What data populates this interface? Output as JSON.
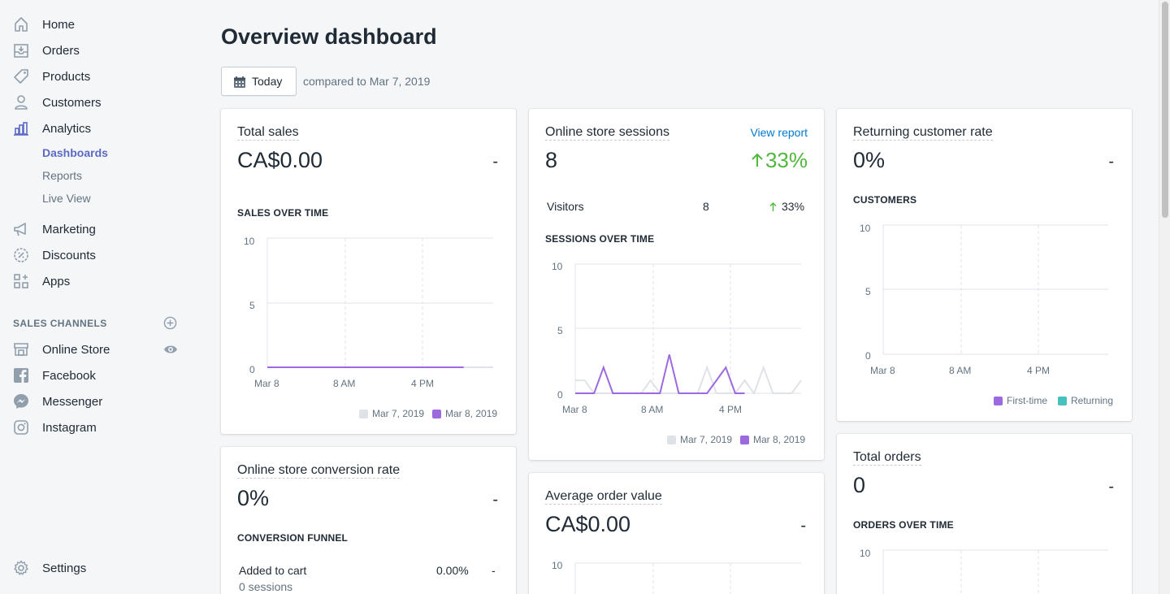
{
  "sidebar": {
    "nav": [
      {
        "label": "Home",
        "icon": "home-icon"
      },
      {
        "label": "Orders",
        "icon": "orders-icon"
      },
      {
        "label": "Products",
        "icon": "tag-icon"
      },
      {
        "label": "Customers",
        "icon": "person-icon"
      },
      {
        "label": "Analytics",
        "icon": "bar-chart-icon"
      }
    ],
    "analytics_sub": [
      "Dashboards",
      "Reports",
      "Live View"
    ],
    "nav2": [
      {
        "label": "Marketing",
        "icon": "megaphone-icon"
      },
      {
        "label": "Discounts",
        "icon": "discount-icon"
      },
      {
        "label": "Apps",
        "icon": "apps-icon"
      }
    ],
    "sales_channels_title": "SALES CHANNELS",
    "channels": [
      {
        "label": "Online Store",
        "icon": "store-icon"
      },
      {
        "label": "Facebook",
        "icon": "facebook-icon"
      },
      {
        "label": "Messenger",
        "icon": "messenger-icon"
      },
      {
        "label": "Instagram",
        "icon": "instagram-icon"
      }
    ],
    "settings_label": "Settings"
  },
  "header": {
    "title": "Overview dashboard",
    "date_button": "Today",
    "compare_text": "compared to Mar 7, 2019"
  },
  "colors": {
    "accent": "#5c6ac4",
    "purple": "#9c6ade",
    "grey": "#dfe3e8",
    "teal": "#47c1bf",
    "green": "#50b83c",
    "link": "#007ace"
  },
  "cards": {
    "total_sales": {
      "title": "Total sales",
      "value": "CA$0.00",
      "dash": "-",
      "sub": "SALES OVER TIME",
      "y_ticks": [
        "10",
        "5",
        "0"
      ],
      "x_ticks": [
        "Mar 8",
        "8 AM",
        "4 PM"
      ],
      "legend": [
        "Mar 7, 2019",
        "Mar 8, 2019"
      ]
    },
    "sessions": {
      "title": "Online store sessions",
      "value": "8",
      "link": "View report",
      "trend": "33%",
      "visitors_label": "Visitors",
      "visitors_value": "8",
      "visitors_trend": "33%",
      "sub": "SESSIONS OVER TIME",
      "y_ticks": [
        "10",
        "5",
        "0"
      ],
      "x_ticks": [
        "Mar 8",
        "8 AM",
        "4 PM"
      ],
      "legend": [
        "Mar 7, 2019",
        "Mar 8, 2019"
      ]
    },
    "returning": {
      "title": "Returning customer rate",
      "value": "0%",
      "dash": "-",
      "sub": "CUSTOMERS",
      "y_ticks": [
        "10",
        "5",
        "0"
      ],
      "x_ticks": [
        "Mar 8",
        "8 AM",
        "4 PM"
      ],
      "legend": [
        "First-time",
        "Returning"
      ]
    },
    "conversion": {
      "title": "Online store conversion rate",
      "value": "0%",
      "dash": "-",
      "sub": "CONVERSION FUNNEL",
      "row_label": "Added to cart",
      "row_sub": "0 sessions",
      "row_pct": "0.00%",
      "row_dash": "-"
    },
    "aov": {
      "title": "Average order value",
      "value": "CA$0.00",
      "dash": "-",
      "y_top": "10"
    },
    "orders": {
      "title": "Total orders",
      "value": "0",
      "dash": "-",
      "sub": "ORDERS OVER TIME",
      "y_top": "10"
    }
  },
  "chart_data": [
    {
      "type": "line",
      "title": "SALES OVER TIME",
      "ylim": [
        0,
        10
      ],
      "x_ticks": [
        "Mar 8",
        "8 AM",
        "4 PM"
      ],
      "series": [
        {
          "name": "Mar 7, 2019",
          "values": [
            0,
            0,
            0,
            0,
            0,
            0,
            0,
            0,
            0,
            0,
            0,
            0,
            0,
            0,
            0,
            0,
            0,
            0,
            0,
            0,
            0,
            0,
            0,
            0
          ]
        },
        {
          "name": "Mar 8, 2019",
          "values": [
            0,
            0,
            0,
            0,
            0,
            0,
            0,
            0,
            0,
            0,
            0,
            0,
            0,
            0,
            0,
            0,
            0,
            0,
            0,
            0,
            0
          ]
        }
      ]
    },
    {
      "type": "line",
      "title": "SESSIONS OVER TIME",
      "ylim": [
        0,
        10
      ],
      "x_ticks": [
        "Mar 8",
        "8 AM",
        "4 PM"
      ],
      "series": [
        {
          "name": "Mar 7, 2019",
          "values": [
            1,
            1,
            0,
            0,
            0,
            0,
            0,
            0,
            1,
            0,
            0,
            0,
            0,
            0,
            2,
            0,
            0,
            0,
            1,
            0,
            2,
            0,
            0,
            0,
            1
          ]
        },
        {
          "name": "Mar 8, 2019",
          "values": [
            0,
            0,
            0,
            2,
            0,
            0,
            0,
            0,
            0,
            0,
            3,
            0,
            0,
            0,
            0,
            1,
            2,
            0,
            0
          ]
        }
      ]
    },
    {
      "type": "line",
      "title": "CUSTOMERS",
      "ylim": [
        0,
        10
      ],
      "x_ticks": [
        "Mar 8",
        "8 AM",
        "4 PM"
      ],
      "series": [
        {
          "name": "First-time",
          "values": []
        },
        {
          "name": "Returning",
          "values": []
        }
      ]
    }
  ]
}
